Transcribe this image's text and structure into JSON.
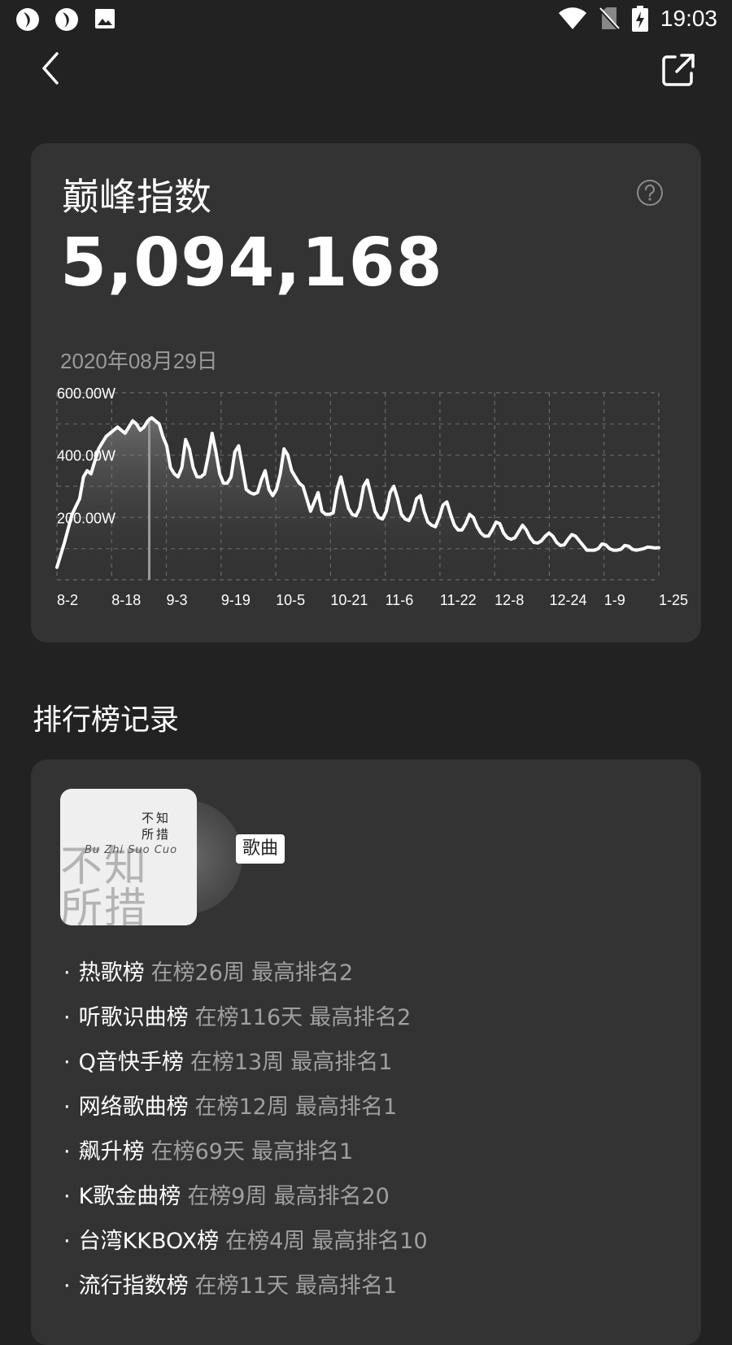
{
  "status_bar": {
    "time": "19:03",
    "icons": [
      "app-icon-1",
      "app-icon-2",
      "image-icon",
      "wifi-icon",
      "no-sim-icon",
      "battery-charging-icon"
    ]
  },
  "nav": {
    "back_icon": "chevron-left-icon",
    "share_icon": "share-icon"
  },
  "peak": {
    "title": "巅峰指数",
    "value": "5,094,168",
    "date": "2020年08月29日",
    "help_icon": "question-icon"
  },
  "chart_data": {
    "type": "area",
    "y_ticks": [
      "600.00W",
      "400.00W",
      "200.00W"
    ],
    "x_ticks": [
      "8-2",
      "8-18",
      "9-3",
      "9-19",
      "10-5",
      "10-21",
      "11-6",
      "11-22",
      "12-8",
      "12-24",
      "1-9",
      "1-25"
    ],
    "ylim": [
      0,
      600
    ],
    "y_unit": "W",
    "line_color": "#ffffff",
    "grid": true,
    "highlight_date": "8-29",
    "series": [
      {
        "values": [
          [
            0,
            40
          ],
          [
            2,
            120
          ],
          [
            4,
            210
          ],
          [
            6,
            260
          ],
          [
            7,
            330
          ],
          [
            8,
            350
          ],
          [
            9,
            340
          ],
          [
            10,
            380
          ],
          [
            11,
            420
          ],
          [
            12,
            440
          ],
          [
            13,
            460
          ],
          [
            14,
            470
          ],
          [
            15,
            480
          ],
          [
            16,
            490
          ],
          [
            17,
            480
          ],
          [
            18,
            470
          ],
          [
            19,
            490
          ],
          [
            20,
            510
          ],
          [
            21,
            500
          ],
          [
            22,
            480
          ],
          [
            23,
            490
          ],
          [
            24,
            510
          ],
          [
            25,
            520
          ],
          [
            26,
            510
          ],
          [
            27,
            500
          ],
          [
            28,
            460
          ],
          [
            29,
            430
          ],
          [
            30,
            360
          ],
          [
            31,
            340
          ],
          [
            32,
            330
          ],
          [
            33,
            360
          ],
          [
            34,
            450
          ],
          [
            35,
            420
          ],
          [
            36,
            360
          ],
          [
            37,
            330
          ],
          [
            38,
            330
          ],
          [
            39,
            340
          ],
          [
            40,
            400
          ],
          [
            41,
            470
          ],
          [
            42,
            410
          ],
          [
            43,
            340
          ],
          [
            44,
            310
          ],
          [
            45,
            310
          ],
          [
            46,
            330
          ],
          [
            47,
            410
          ],
          [
            48,
            430
          ],
          [
            49,
            360
          ],
          [
            50,
            290
          ],
          [
            51,
            280
          ],
          [
            52,
            275
          ],
          [
            53,
            280
          ],
          [
            54,
            320
          ],
          [
            55,
            350
          ],
          [
            56,
            290
          ],
          [
            57,
            270
          ],
          [
            58,
            290
          ],
          [
            59,
            340
          ],
          [
            60,
            420
          ],
          [
            61,
            400
          ],
          [
            62,
            350
          ],
          [
            63,
            330
          ],
          [
            64,
            310
          ],
          [
            65,
            300
          ],
          [
            66,
            260
          ],
          [
            67,
            220
          ],
          [
            68,
            250
          ],
          [
            69,
            280
          ],
          [
            70,
            220
          ],
          [
            71,
            210
          ],
          [
            72,
            210
          ],
          [
            73,
            215
          ],
          [
            74,
            290
          ],
          [
            75,
            330
          ],
          [
            76,
            280
          ],
          [
            77,
            230
          ],
          [
            78,
            210
          ],
          [
            79,
            205
          ],
          [
            80,
            230
          ],
          [
            81,
            300
          ],
          [
            82,
            320
          ],
          [
            83,
            270
          ],
          [
            84,
            220
          ],
          [
            85,
            200
          ],
          [
            86,
            195
          ],
          [
            87,
            220
          ],
          [
            88,
            280
          ],
          [
            89,
            300
          ],
          [
            90,
            260
          ],
          [
            91,
            210
          ],
          [
            92,
            195
          ],
          [
            93,
            190
          ],
          [
            94,
            215
          ],
          [
            95,
            260
          ],
          [
            96,
            270
          ],
          [
            97,
            220
          ],
          [
            98,
            185
          ],
          [
            99,
            175
          ],
          [
            100,
            170
          ],
          [
            101,
            200
          ],
          [
            102,
            240
          ],
          [
            103,
            250
          ],
          [
            104,
            210
          ],
          [
            105,
            175
          ],
          [
            106,
            160
          ],
          [
            107,
            160
          ],
          [
            108,
            180
          ],
          [
            109,
            210
          ],
          [
            110,
            200
          ],
          [
            111,
            170
          ],
          [
            112,
            150
          ],
          [
            113,
            140
          ],
          [
            114,
            140
          ],
          [
            115,
            160
          ],
          [
            116,
            185
          ],
          [
            117,
            180
          ],
          [
            118,
            150
          ],
          [
            119,
            135
          ],
          [
            120,
            130
          ],
          [
            121,
            135
          ],
          [
            122,
            155
          ],
          [
            123,
            175
          ],
          [
            124,
            160
          ],
          [
            125,
            135
          ],
          [
            126,
            120
          ],
          [
            127,
            118
          ],
          [
            128,
            125
          ],
          [
            129,
            140
          ],
          [
            130,
            150
          ],
          [
            131,
            140
          ],
          [
            132,
            120
          ],
          [
            133,
            110
          ],
          [
            134,
            112
          ],
          [
            135,
            130
          ],
          [
            136,
            145
          ],
          [
            137,
            140
          ],
          [
            138,
            125
          ],
          [
            139,
            110
          ],
          [
            140,
            95
          ],
          [
            141,
            95
          ],
          [
            142,
            95
          ],
          [
            143,
            100
          ],
          [
            144,
            115
          ],
          [
            145,
            112
          ],
          [
            146,
            100
          ],
          [
            147,
            95
          ],
          [
            148,
            95
          ],
          [
            149,
            98
          ],
          [
            150,
            110
          ],
          [
            151,
            108
          ],
          [
            152,
            98
          ],
          [
            153,
            95
          ],
          [
            154,
            97
          ],
          [
            155,
            100
          ],
          [
            156,
            105
          ],
          [
            157,
            104
          ],
          [
            158,
            102
          ],
          [
            159,
            103
          ]
        ]
      }
    ]
  },
  "rank_section": {
    "title": "排行榜记录",
    "album": {
      "small_text_1": "不知",
      "small_text_2": "所措",
      "big_text": "不知",
      "big_text_2": "所措",
      "script_text": "Bu Zhi Suo Cuo"
    },
    "tag_label": "歌曲",
    "items": [
      {
        "name": "热歌榜",
        "stat1": "在榜26周",
        "stat2": "最高排名2"
      },
      {
        "name": "听歌识曲榜",
        "stat1": "在榜116天",
        "stat2": "最高排名2"
      },
      {
        "name": "Q音快手榜",
        "stat1": "在榜13周",
        "stat2": "最高排名1"
      },
      {
        "name": "网络歌曲榜",
        "stat1": "在榜12周",
        "stat2": "最高排名1"
      },
      {
        "name": "飙升榜",
        "stat1": "在榜69天",
        "stat2": "最高排名1"
      },
      {
        "name": "K歌金曲榜",
        "stat1": "在榜9周",
        "stat2": "最高排名20"
      },
      {
        "name": "台湾KKBOX榜",
        "stat1": "在榜4周",
        "stat2": "最高排名10"
      },
      {
        "name": "流行指数榜",
        "stat1": "在榜11天",
        "stat2": "最高排名1"
      }
    ]
  }
}
